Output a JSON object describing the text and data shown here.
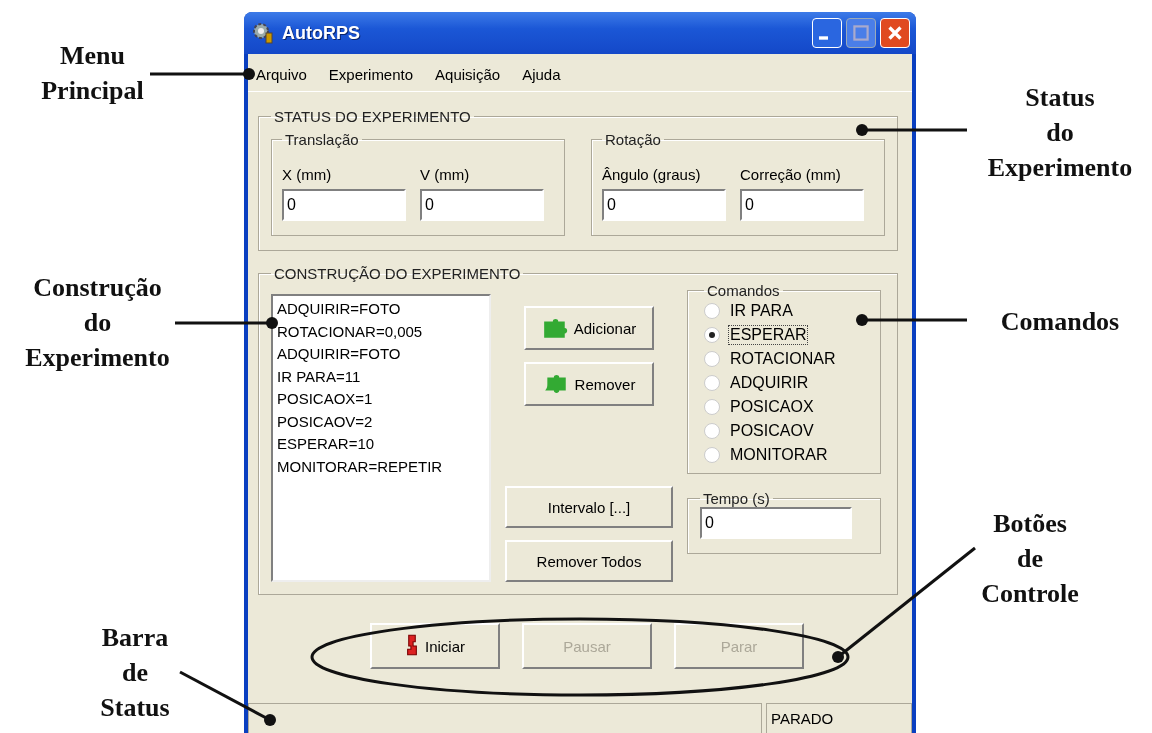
{
  "window": {
    "title": "AutoRPS"
  },
  "menu": [
    "Arquivo",
    "Experimento",
    "Aquisição",
    "Ajuda"
  ],
  "status_group": {
    "title": "STATUS DO EXPERIMENTO",
    "subgroups": [
      {
        "title": "Translação",
        "fields": [
          {
            "label": "X (mm)",
            "value": "0"
          },
          {
            "label": "V (mm)",
            "value": "0"
          }
        ]
      },
      {
        "title": "Rotação",
        "fields": [
          {
            "label": "Ângulo (graus)",
            "value": "0"
          },
          {
            "label": "Correção (mm)",
            "value": "0"
          }
        ]
      }
    ]
  },
  "construction_group": {
    "title": "CONSTRUÇÃO DO EXPERIMENTO",
    "steps": [
      "ADQUIRIR=FOTO",
      "ROTACIONAR=0,005",
      "ADQUIRIR=FOTO",
      "IR PARA=11",
      "POSICAOX=1",
      "POSICAOV=2",
      "ESPERAR=10",
      "MONITORAR=REPETIR"
    ],
    "add_button": "Adicionar",
    "remove_button": "Remover",
    "interval_button": "Intervalo [...]",
    "remove_all_button": "Remover Todos",
    "commands": {
      "title": "Comandos",
      "options": [
        {
          "label": "IR PARA",
          "selected": false
        },
        {
          "label": "ESPERAR",
          "selected": true
        },
        {
          "label": "ROTACIONAR",
          "selected": false
        },
        {
          "label": "ADQUIRIR",
          "selected": false
        },
        {
          "label": "POSICAOX",
          "selected": false
        },
        {
          "label": "POSICAOV",
          "selected": false
        },
        {
          "label": "MONITORAR",
          "selected": false
        }
      ]
    },
    "time": {
      "title": "Tempo (s)",
      "value": "0"
    }
  },
  "control_buttons": [
    {
      "label": "Iniciar",
      "disabled": false
    },
    {
      "label": "Pausar",
      "disabled": true
    },
    {
      "label": "Parar",
      "disabled": true
    }
  ],
  "status_bar": [
    "PARADO"
  ],
  "annotations": [
    {
      "lines": [
        "Menu",
        "Principal"
      ]
    },
    {
      "lines": [
        "Status",
        "do",
        "Experimento"
      ]
    },
    {
      "lines": [
        "Construção",
        "do",
        "Experimento"
      ]
    },
    {
      "lines": [
        "Comandos"
      ]
    },
    {
      "lines": [
        "Botões",
        "de",
        "Controle"
      ]
    },
    {
      "lines": [
        "Barra",
        "de",
        "Status"
      ]
    }
  ]
}
